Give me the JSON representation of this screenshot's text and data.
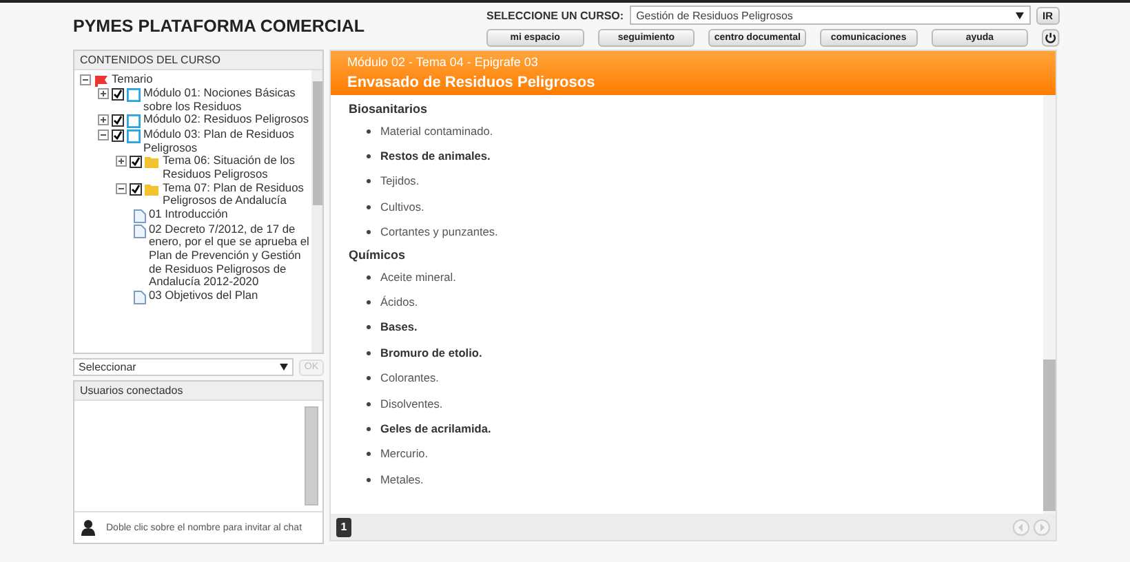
{
  "header": {
    "title": "PYMES PLATAFORMA COMERCIAL",
    "course_label": "SELECCIONE UN CURSO:",
    "course_value": "Gestión de Residuos Peligrosos",
    "go_button": "IR",
    "nav": [
      "mi espacio",
      "seguimiento",
      "centro documental",
      "comunicaciones",
      "ayuda"
    ]
  },
  "course_tree": {
    "title": "CONTENIDOS DEL CURSO",
    "nodes": [
      {
        "kind": "root",
        "label": "Temario",
        "expanded": true,
        "children": [
          {
            "kind": "module",
            "label": "Módulo 01: Nociones Básicas sobre los Residuos",
            "expanded": false,
            "checked": true
          },
          {
            "kind": "module",
            "label": "Módulo 02: Residuos Peligrosos",
            "expanded": false,
            "checked": true
          },
          {
            "kind": "module",
            "label": "Módulo 03: Plan de Residuos Peligrosos",
            "expanded": true,
            "checked": true,
            "children": [
              {
                "kind": "topic",
                "label": "Tema 06: Situación de los Residuos Peligrosos",
                "expanded": false,
                "checked": true
              },
              {
                "kind": "topic",
                "label": "Tema 07: Plan de Residuos Peligrosos de Andalucía",
                "expanded": true,
                "checked": true,
                "children": [
                  {
                    "kind": "doc",
                    "label": "01 Introducción"
                  },
                  {
                    "kind": "doc",
                    "label": "02 Decreto 7/2012, de 17 de enero, por el que se aprueba el Plan de Prevención y Gestión de Residuos Peligrosos de Andalucía 2012-2020"
                  },
                  {
                    "kind": "doc",
                    "label": "03 Objetivos del Plan"
                  }
                ]
              }
            ]
          }
        ]
      }
    ],
    "select": {
      "value": "Seleccionar",
      "button": "OK"
    }
  },
  "users_panel": {
    "title": "Usuarios conectados",
    "hint": "Doble clic sobre el nombre para invitar al chat"
  },
  "content": {
    "breadcrumb": "Módulo 02 - Tema 04 - Epigrafe 03",
    "title": "Envasado de Residuos Peligrosos",
    "sections": [
      {
        "heading": "Biosanitarios",
        "items": [
          {
            "text": "Material contaminado.",
            "bold": false
          },
          {
            "text": "Restos de animales.",
            "bold": true
          },
          {
            "text": "Tejidos.",
            "bold": false
          },
          {
            "text": "Cultivos.",
            "bold": false
          },
          {
            "text": "Cortantes y punzantes.",
            "bold": false
          }
        ]
      },
      {
        "heading": "Químicos",
        "items": [
          {
            "text": "Aceite mineral.",
            "bold": false
          },
          {
            "text": "Ácidos.",
            "bold": false
          },
          {
            "text": "Bases.",
            "bold": true
          },
          {
            "text": "Bromuro de etolio.",
            "bold": true
          },
          {
            "text": "Colorantes.",
            "bold": false
          },
          {
            "text": "Disolventes.",
            "bold": false
          },
          {
            "text": "Geles de acrilamida.",
            "bold": true
          },
          {
            "text": "Mercurio.",
            "bold": false
          },
          {
            "text": "Metales.",
            "bold": false
          }
        ]
      }
    ],
    "page_button": "1"
  }
}
